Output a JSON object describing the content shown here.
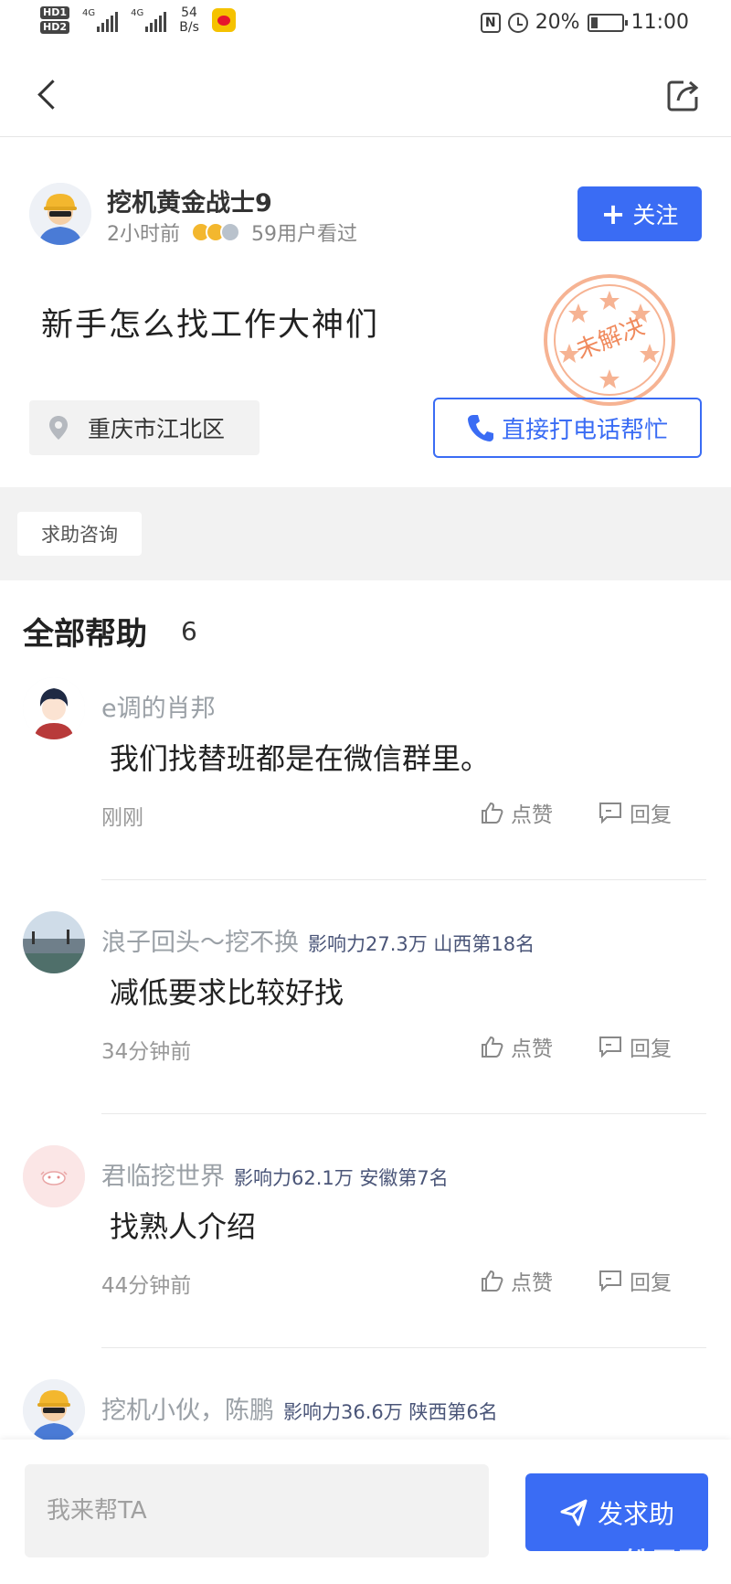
{
  "status_bar": {
    "net_speed_value": "54",
    "net_speed_unit": "B/s",
    "signal_label": "4G",
    "battery": "20%",
    "time": "11:00"
  },
  "post": {
    "author_name": "挖机黄金战士9",
    "posted_time": "2小时前",
    "view_count": "59用户看过",
    "follow_label": "关注",
    "title": "新手怎么找工作大神们",
    "status_stamp": "未解决",
    "location": "重庆市江北区",
    "call_label": "直接打电话帮忙",
    "tag": "求助咨询"
  },
  "answers": {
    "section_title": "全部帮助",
    "count": "6",
    "like_label": "点赞",
    "reply_label": "回复",
    "items": [
      {
        "name": "e调的肖邦",
        "badge": "",
        "text": "我们找替班都是在微信群里。",
        "time": "刚刚"
      },
      {
        "name": "浪子回头～挖不换",
        "badge": "影响力27.3万 山西第18名",
        "text": "减低要求比较好找",
        "time": "34分钟前"
      },
      {
        "name": "君临挖世界",
        "badge": "影响力62.1万 安徽第7名",
        "text": "找熟人介绍",
        "time": "44分钟前"
      },
      {
        "name": "挖机小伙，陈鹏",
        "badge": "影响力36.6万 陕西第6名",
        "text": "",
        "time": ""
      }
    ]
  },
  "bottom": {
    "input_placeholder": "我来帮TA",
    "send_label": "发求助",
    "watermark": "铁甲网"
  },
  "colors": {
    "accent": "#3a6cf4",
    "stamp": "#f08a5d"
  }
}
